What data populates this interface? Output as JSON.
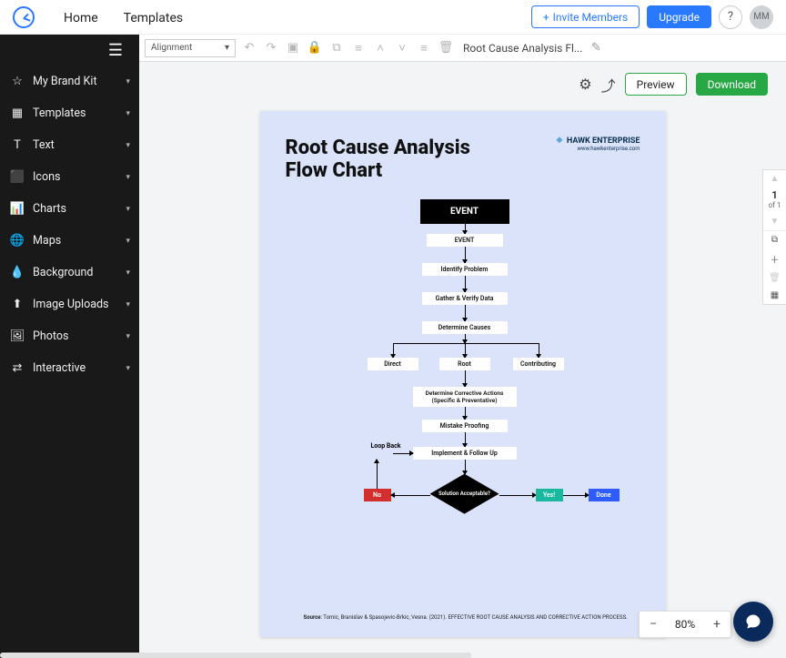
{
  "nav": {
    "home": "Home",
    "templates": "Templates"
  },
  "header": {
    "invite": "Invite Members",
    "upgrade": "Upgrade",
    "preview": "Preview",
    "download": "Download",
    "avatar": "MM",
    "help": "?"
  },
  "sidebar": {
    "items": [
      {
        "icon": "☆",
        "label": "My Brand Kit"
      },
      {
        "icon": "▦",
        "label": "Templates"
      },
      {
        "icon": "T",
        "label": "Text"
      },
      {
        "icon": "⬛",
        "label": "Icons"
      },
      {
        "icon": "📊",
        "label": "Charts"
      },
      {
        "icon": "🌐",
        "label": "Maps"
      },
      {
        "icon": "💧",
        "label": "Background"
      },
      {
        "icon": "⬆",
        "label": "Image Uploads"
      },
      {
        "icon": "🖼",
        "label": "Photos"
      },
      {
        "icon": "⇄",
        "label": "Interactive"
      }
    ]
  },
  "toolbar": {
    "alignment": "Alignment",
    "doc_title": "Root Cause Analysis Fl..."
  },
  "doc": {
    "title_l1": "Root Cause Analysis",
    "title_l2": "Flow Chart",
    "brand_name": "HAWK ENTERPRISE",
    "brand_url": "www.hawkenterprise.com",
    "nodes": {
      "event_main": "EVENT",
      "event": "EVENT",
      "identify": "Identify Problem",
      "gather": "Gather & Verify Data",
      "determine": "Determine Causes",
      "direct": "Direct",
      "root": "Root",
      "contributing": "Contributing",
      "corrective": "Determine Corrective Actions (Specific & Preventative)",
      "mistake": "Mistake Proofing",
      "implement": "Implement & Follow Up",
      "loop": "Loop Back",
      "decision": "Solution Acceptable?",
      "no": "No",
      "yes": "Yes!",
      "done": "Done"
    },
    "source_label": "Source",
    "source_text": ": Tomic, Branislav & Spasojevic-Brkic, Vesna. (2021). EFFECTIVE ROOT CAUSE ANALYSIS AND CORRECTIVE ACTION PROCESS."
  },
  "page_nav": {
    "current": "1",
    "of": "of 1"
  },
  "zoom": {
    "value": "80%"
  }
}
